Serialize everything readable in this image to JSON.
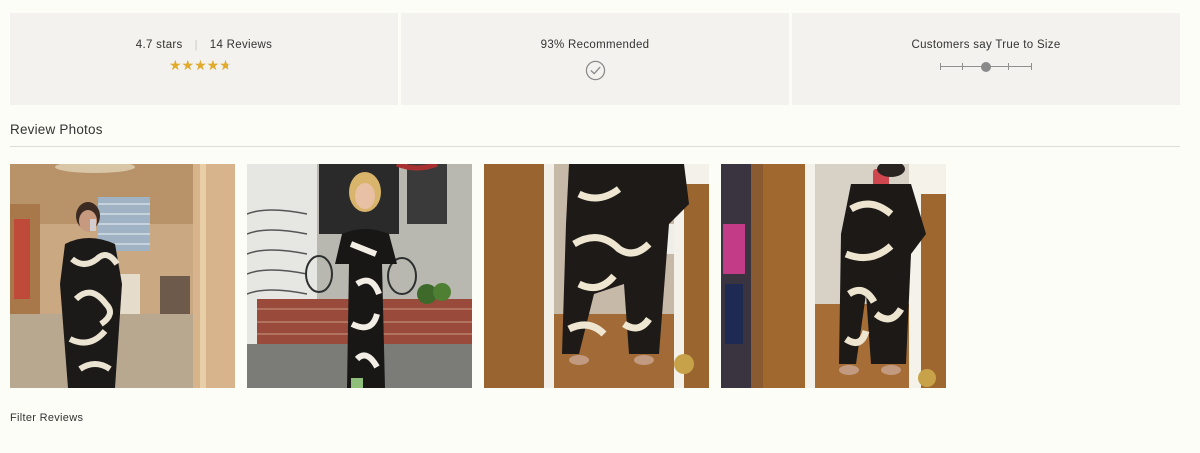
{
  "summary": {
    "rating_text": "4.7 stars",
    "review_count": "14 Reviews",
    "rating_value": 4.7,
    "rating_max": 5,
    "recommended_text": "93% Recommended",
    "fit_text": "Customers say True to Size",
    "fit_level": 0.5,
    "star_color": "#e2ab2c"
  },
  "photos_section": {
    "heading": "Review Photos"
  },
  "filter": {
    "label": "Filter Reviews"
  }
}
